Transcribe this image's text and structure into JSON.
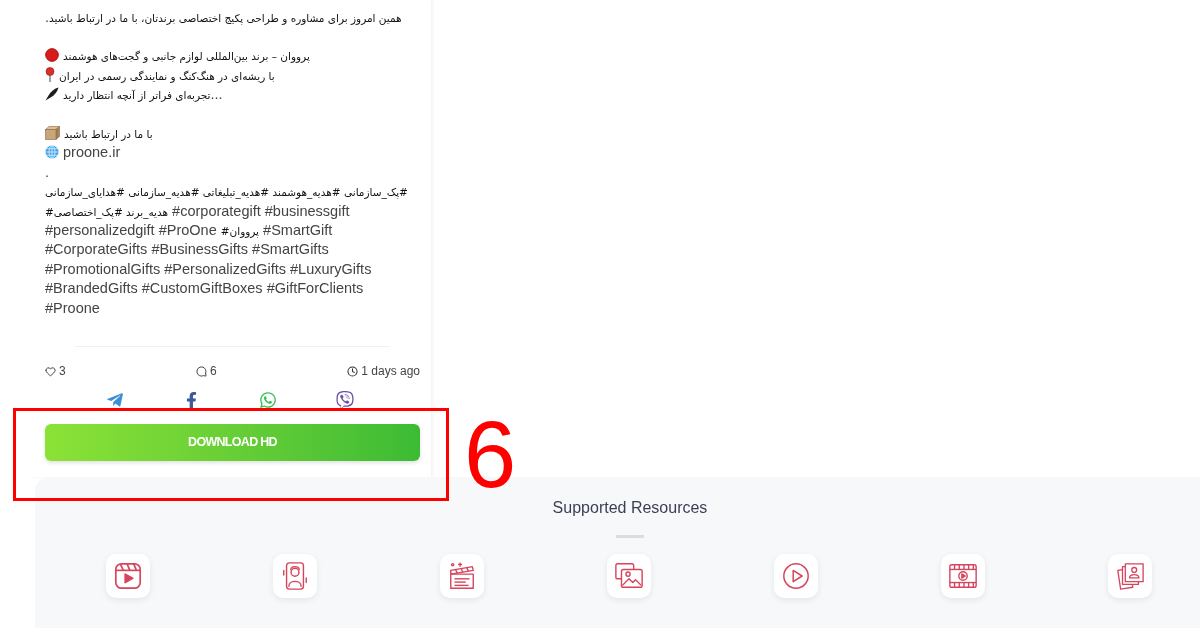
{
  "post": {
    "caption": {
      "paragraphs": [
        [
          {
            "kind": "text",
            "text": "همین امروز برای مشاوره و طراحی پکیج اختصاصی برندتان، با ما در ارتباط باشید."
          }
        ],
        [
          {
            "kind": "circle",
            "text": "پرووان – برند بین‌المللی لوازم جانبی و گجت‌های هوشمند"
          },
          {
            "kind": "pin",
            "text": "با ریشه‌ای در هنگ‌کنگ و نمایندگی رسمی در ایران"
          },
          {
            "kind": "pen",
            "text": "...تجربه‌ای فراتر از آنچه انتظار دارید"
          }
        ],
        [
          {
            "kind": "package",
            "text": "با ما در ارتباط باشید"
          },
          {
            "kind": "globe",
            "text": "proone.ir"
          },
          {
            "kind": "text",
            "text": "."
          }
        ]
      ],
      "hashtags": {
        "persian_line": "#پک_سازمانی #هدیه_هوشمند #هدیه_تبلیغاتی #هدیه_سازمانی #هدایای_سازمانی",
        "lines": [
          "#هدیه_برند #پک_اختصاصی #corporategift #businessgift",
          "#personalizedgift #ProOne #پرووان #SmartGift",
          "#CorporateGifts #BusinessGifts #SmartGifts",
          "#PromotionalGifts #PersonalizedGifts #LuxuryGifts",
          "#BrandedGifts #CustomGiftBoxes #GiftForClients",
          "#Proone"
        ]
      }
    },
    "stats": {
      "likes": "3",
      "comments": "6",
      "posted": "1 days ago"
    },
    "download_button": "DOWNLOAD HD"
  },
  "supported_resources": {
    "title": "Supported Resources"
  },
  "annotation": {
    "number": "6"
  }
}
